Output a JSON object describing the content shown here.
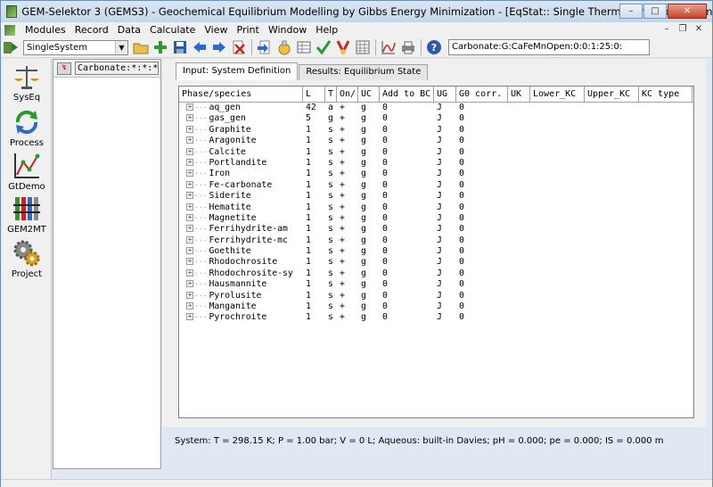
{
  "window": {
    "title": "GEM-Selektor 3 (GEMS3) - Geochemical Equilibrium Modelling by Gibbs Energy Minimization - [EqStat:: Single Thermodynamic System in Project Carbonate ]"
  },
  "menu": [
    "Modules",
    "Record",
    "Data",
    "Calculate",
    "View",
    "Print",
    "Window",
    "Help"
  ],
  "toolbar": {
    "combo_value": "SingleSystem",
    "record_key": "Carbonate:G:CaFeMnOpen:0:0:1:25:0:"
  },
  "modules": [
    {
      "label": "SysEq",
      "icon": "scales-icon"
    },
    {
      "label": "Process",
      "icon": "cycle-arrows-icon"
    },
    {
      "label": "GtDemo",
      "icon": "plot-graph-icon"
    },
    {
      "label": "GEM2MT",
      "icon": "transport-columns-icon"
    },
    {
      "label": "Project",
      "icon": "gears-icon"
    }
  ],
  "nav": {
    "key_text": "Carbonate:*:*:*:*:*:*:*"
  },
  "tabs": [
    {
      "label": "Input: System Definition",
      "active": true
    },
    {
      "label": "Results: Equilibrium State",
      "active": false
    }
  ],
  "table": {
    "columns": [
      "Phase/species",
      "L",
      "T",
      "On/",
      "UC",
      "Add to BC",
      "UG",
      "G0 corr.",
      "UK",
      "Lower_KC",
      "Upper_KC",
      "KC type"
    ],
    "rows": [
      [
        "aq_gen",
        "42",
        "a",
        "+",
        "g",
        "0",
        "J",
        "0"
      ],
      [
        "gas_gen",
        "5",
        "g",
        "+",
        "g",
        "0",
        "J",
        "0"
      ],
      [
        "Graphite",
        "1",
        "s",
        "+",
        "g",
        "0",
        "J",
        "0"
      ],
      [
        "Aragonite",
        "1",
        "s",
        "+",
        "g",
        "0",
        "J",
        "0"
      ],
      [
        "Calcite",
        "1",
        "s",
        "+",
        "g",
        "0",
        "J",
        "0"
      ],
      [
        "Portlandite",
        "1",
        "s",
        "+",
        "g",
        "0",
        "J",
        "0"
      ],
      [
        "Iron",
        "1",
        "s",
        "+",
        "g",
        "0",
        "J",
        "0"
      ],
      [
        "Fe-carbonate",
        "1",
        "s",
        "+",
        "g",
        "0",
        "J",
        "0"
      ],
      [
        "Siderite",
        "1",
        "s",
        "+",
        "g",
        "0",
        "J",
        "0"
      ],
      [
        "Hematite",
        "1",
        "s",
        "+",
        "g",
        "0",
        "J",
        "0"
      ],
      [
        "Magnetite",
        "1",
        "s",
        "+",
        "g",
        "0",
        "J",
        "0"
      ],
      [
        "Ferrihydrite-am",
        "1",
        "s",
        "+",
        "g",
        "0",
        "J",
        "0"
      ],
      [
        "Ferrihydrite-mc",
        "1",
        "s",
        "+",
        "g",
        "0",
        "J",
        "0"
      ],
      [
        "Goethite",
        "1",
        "s",
        "+",
        "g",
        "0",
        "J",
        "0"
      ],
      [
        "Rhodochrosite",
        "1",
        "s",
        "+",
        "g",
        "0",
        "J",
        "0"
      ],
      [
        "Rhodochrosite-sy",
        "1",
        "s",
        "+",
        "g",
        "0",
        "J",
        "0"
      ],
      [
        "Hausmannite",
        "1",
        "s",
        "+",
        "g",
        "0",
        "J",
        "0"
      ],
      [
        "Pyrolusite",
        "1",
        "s",
        "+",
        "g",
        "0",
        "J",
        "0"
      ],
      [
        "Manganite",
        "1",
        "s",
        "+",
        "g",
        "0",
        "J",
        "0"
      ],
      [
        "Pyrochroite",
        "1",
        "s",
        "+",
        "g",
        "0",
        "J",
        "0"
      ]
    ]
  },
  "status": "System:  T =  298.15 K;  P =     1.00 bar;  V =          0 L;  Aqueous: built-in Davies;  pH = 0.000;  pe =  0.000;  IS = 0.000 m"
}
